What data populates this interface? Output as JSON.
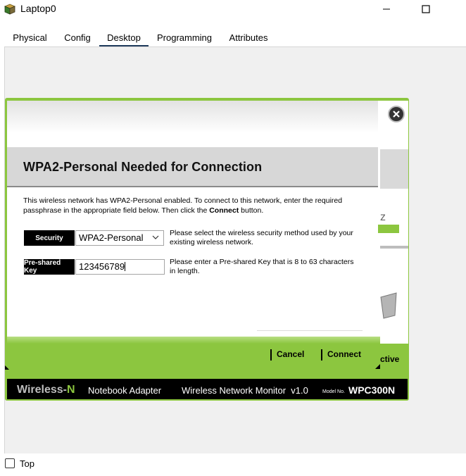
{
  "window": {
    "title": "Laptop0",
    "app_icon": "laptop-app-icon",
    "controls": [
      "minimize-icon",
      "maximize-icon"
    ]
  },
  "tabs": [
    {
      "label": "Physical",
      "active": false
    },
    {
      "label": "Config",
      "active": false
    },
    {
      "label": "Desktop",
      "active": true
    },
    {
      "label": "Programming",
      "active": false
    },
    {
      "label": "Attributes",
      "active": false
    }
  ],
  "dialog": {
    "title": "WPA2-Personal Needed for Connection",
    "description_prefix": "This wireless network has WPA2-Personal enabled. To connect to this network, enter the required passphrase in the appropriate field below. Then click the ",
    "description_emphasis": "Connect",
    "description_suffix": " button.",
    "security": {
      "label": "Security",
      "selected": "WPA2-Personal",
      "help": "Please select the wireless security method used by your existing wireless network."
    },
    "psk": {
      "label": "Pre-shared Key",
      "value": "123456789",
      "help": "Please enter a Pre-shared Key that is 8 to 63 characters in length."
    },
    "buttons": {
      "cancel": "Cancel",
      "connect": "Connect"
    }
  },
  "background": {
    "partial_text_1": "z",
    "partial_text_2": "ctive"
  },
  "footer": {
    "brand_prefix": "Wireless-",
    "brand_suffix": "N",
    "product": "Notebook Adapter",
    "app_name": "Wireless Network Monitor  v1.0",
    "model_label": "Model No.",
    "model_number": "WPC300N"
  },
  "bottom": {
    "checkbox_label": "Top",
    "checked": false
  },
  "colors": {
    "accent_green": "#8cc63f",
    "header_gray": "#d7d7d7",
    "label_black": "#000000"
  }
}
